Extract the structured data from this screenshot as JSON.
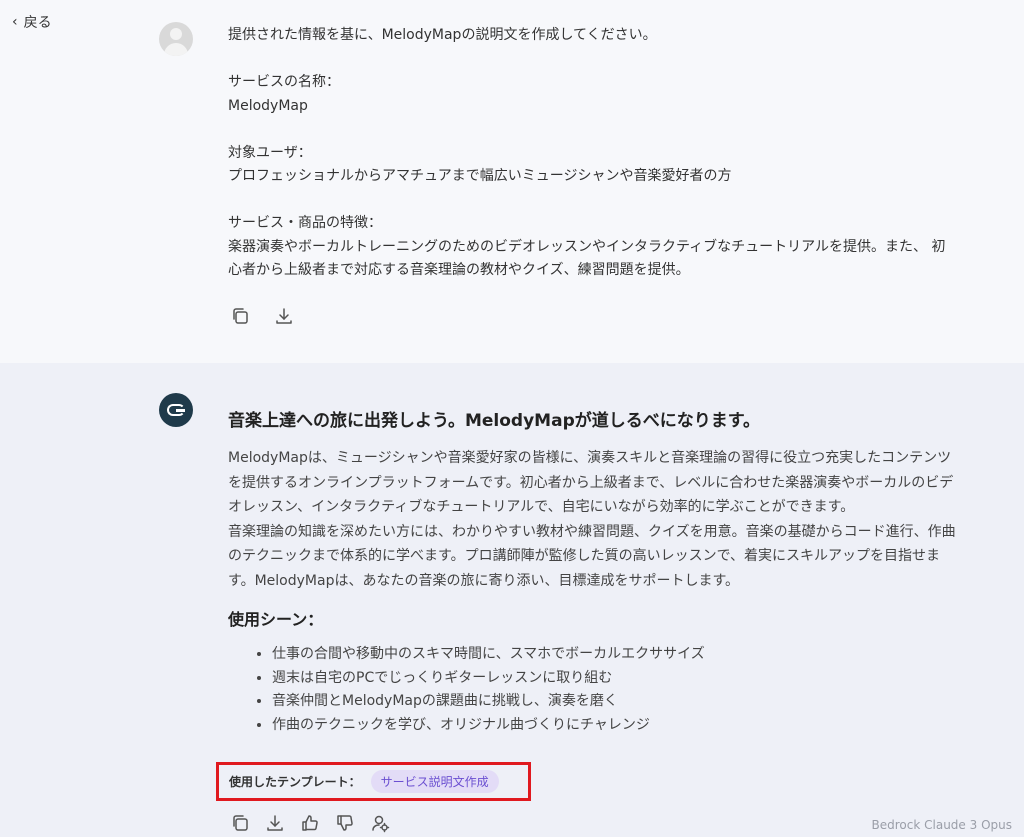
{
  "nav": {
    "back_label": "戻る"
  },
  "user_message": {
    "lines": [
      "提供された情報を基に、MelodyMapの説明文を作成してください。",
      "",
      "サービスの名称：",
      "MelodyMap",
      "",
      "対象ユーザ：",
      "プロフェッショナルからアマチュアまで幅広いミュージシャンや音楽愛好者の方",
      "",
      "サービス・商品の特徴：",
      "楽器演奏やボーカルトレーニングのためのビデオレッスンやインタラクティブなチュートリアルを提供。また、 初",
      "心者から上級者まで対応する音楽理論の教材やクイズ、練習問題を提供。"
    ],
    "actions": [
      "copy-icon",
      "download-icon"
    ]
  },
  "ai_message": {
    "title": "音楽上達への旅に出発しよう。MelodyMapが道しるべになります。",
    "body_lines": [
      "MelodyMapは、ミュージシャンや音楽愛好家の皆様に、演奏スキルと音楽理論の習得に役立つ充実したコンテンツ",
      "を提供するオンラインプラットフォームです。初心者から上級者まで、レベルに合わせた楽器演奏やボーカルのビデ",
      "オレッスン、インタラクティブなチュートリアルで、自宅にいながら効率的に学ぶことができます。",
      "音楽理論の知識を深めたい方には、わかりやすい教材や練習問題、クイズを用意。音楽の基礎からコード進行、作曲",
      "のテクニックまで体系的に学べます。プロ講師陣が監修した質の高いレッスンで、着実にスキルアップを目指せま",
      "す。MelodyMapは、あなたの音楽の旅に寄り添い、目標達成をサポートします。"
    ],
    "subheading": "使用シーン：",
    "list": [
      "仕事の合間や移動中のスキマ時間に、スマホでボーカルエクササイズ",
      "週末は自宅のPCでじっくりギターレッスンに取り組む",
      "音楽仲間とMelodyMapの課題曲に挑戦し、演奏を磨く",
      "作曲のテクニックを学び、オリジナル曲づくりにチャレンジ"
    ],
    "template_label": "使用したテンプレート：",
    "template_name": "サービス説明文作成",
    "actions": [
      "copy-icon",
      "download-icon",
      "thumbs-up-icon",
      "thumbs-down-icon",
      "prompt-settings-icon"
    ],
    "model": "Bedrock Claude 3 Opus"
  },
  "colors": {
    "highlight_border": "#e0191f",
    "template_chip_text": "#6b4fd1",
    "template_chip_bg": "#e3dcf7",
    "ai_section_bg": "#eef0f7",
    "user_section_bg": "#f7f8fb"
  }
}
